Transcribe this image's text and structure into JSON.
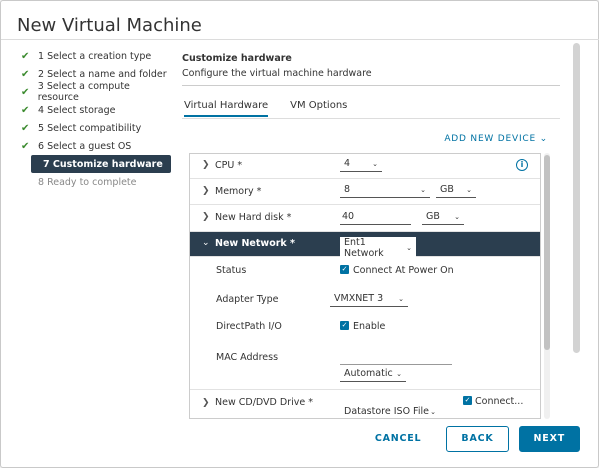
{
  "window": {
    "title": "New Virtual Machine"
  },
  "steps": [
    {
      "label": "1 Select a creation type",
      "state": "done"
    },
    {
      "label": "2 Select a name and folder",
      "state": "done"
    },
    {
      "label": "3 Select a compute resource",
      "state": "done"
    },
    {
      "label": "4 Select storage",
      "state": "done"
    },
    {
      "label": "5 Select compatibility",
      "state": "done"
    },
    {
      "label": "6 Select a guest OS",
      "state": "done"
    },
    {
      "label": "7 Customize hardware",
      "state": "active"
    },
    {
      "label": "8 Ready to complete",
      "state": "pending"
    }
  ],
  "content": {
    "title": "Customize hardware",
    "subtitle": "Configure the virtual machine hardware"
  },
  "tabs": [
    "Virtual Hardware",
    "VM Options"
  ],
  "add_device": "ADD NEW DEVICE",
  "hardware": {
    "cpu": {
      "label": "CPU *",
      "value": "4"
    },
    "memory": {
      "label": "Memory *",
      "value": "8",
      "unit": "GB"
    },
    "disk": {
      "label": "New Hard disk *",
      "value": "40",
      "unit": "GB"
    },
    "network": {
      "label": "New Network *",
      "value": "Ent1 Network",
      "status_label": "Status",
      "status_value": "Connect At Power On",
      "adapter_label": "Adapter Type",
      "adapter_value": "VMXNET 3",
      "directpath_label": "DirectPath I/O",
      "directpath_value": "Enable",
      "mac_label": "MAC Address",
      "mac_value": "",
      "mac_mode": "Automatic"
    },
    "cdrom": {
      "label": "New CD/DVD Drive *",
      "value": "Datastore ISO File",
      "connect": "Connect..."
    }
  },
  "buttons": {
    "cancel": "CANCEL",
    "back": "BACK",
    "next": "NEXT"
  }
}
